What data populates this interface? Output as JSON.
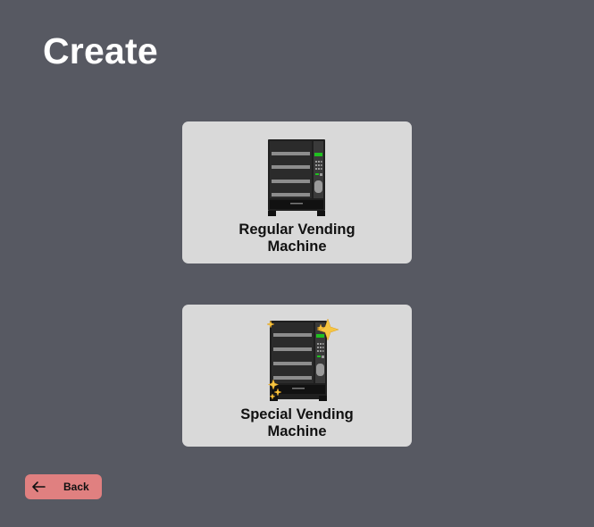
{
  "header": {
    "title": "Create"
  },
  "options": {
    "regular": {
      "label": "Regular Vending Machine",
      "icon": "vending-machine-icon"
    },
    "special": {
      "label": "Special Vending Machine",
      "icon": "sparkling-vending-machine-icon"
    }
  },
  "footer": {
    "back_label": "Back",
    "back_icon": "arrow-left-icon"
  },
  "colors": {
    "background": "#575962",
    "card": "#d9d9d9",
    "back_button": "#e08080",
    "title": "#ffffff"
  }
}
